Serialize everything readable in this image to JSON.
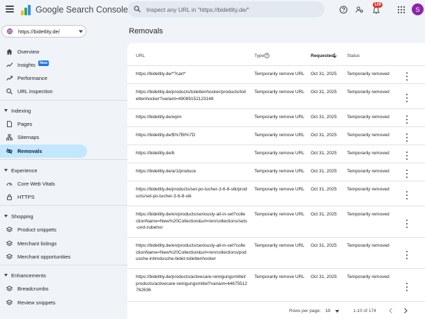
{
  "header": {
    "app_name": "Google Search Console",
    "search_placeholder": "Inspect any URL in \"https://bidetlity.de/\"",
    "notification_count": "129",
    "avatar_letter": "S"
  },
  "sidebar": {
    "property": "https://bidetlity.de/",
    "items_top": [
      {
        "label": "Overview",
        "icon": "home-icon"
      },
      {
        "label": "Insights",
        "icon": "insights-icon",
        "badge": "New"
      },
      {
        "label": "Performance",
        "icon": "trending-icon"
      },
      {
        "label": "URL inspection",
        "icon": "search-icon"
      }
    ],
    "sections": [
      {
        "label": "Indexing",
        "items": [
          "Pages",
          "Sitemaps",
          "Removals"
        ]
      },
      {
        "label": "Experience",
        "items": [
          "Core Web Vitals",
          "HTTPS"
        ]
      },
      {
        "label": "Shopping",
        "items": [
          "Product snippets",
          "Merchant listings",
          "Merchant opportunities"
        ]
      },
      {
        "label": "Enhancements",
        "items": [
          "Breadcrumbs",
          "Review snippets"
        ]
      }
    ],
    "active_item": "Removals"
  },
  "main": {
    "title": "Removals",
    "columns": {
      "url": "URL",
      "type": "Type",
      "requested": "Requested",
      "status": "Status"
    },
    "rows": [
      {
        "url": "https://bidetlity.de/*?cart*",
        "type": "Temporarily remove URL",
        "date": "Oct 31, 2025",
        "status": "Temporarily removed"
      },
      {
        "url": "https://bidetlity.de/products/toilettenhocker/products/toilettenhocker?variant=49089152123148",
        "type": "Temporarily remove URL",
        "date": "Oct 31, 2025",
        "status": "Temporarily removed"
      },
      {
        "url": "https://bidetlity.de/wpm",
        "type": "Temporarily remove URL",
        "date": "Oct 31, 2025",
        "status": "Temporarily removed"
      },
      {
        "url": "https://bidetlity.de/$%7Bt%7D",
        "type": "Temporarily remove URL",
        "date": "Oct 31, 2025",
        "status": "Temporarily removed"
      },
      {
        "url": "https://bidetlity.de/b",
        "type": "Temporarily remove URL",
        "date": "Oct 31, 2025",
        "status": "Temporarily removed"
      },
      {
        "url": "https://bidetlity.de/a/1/produce",
        "type": "Temporarily remove URL",
        "date": "Oct 31, 2025",
        "status": "Temporarily removed"
      },
      {
        "url": "https://bidetlity.de/products/set-po-tucher-3-6-8-stk/products/set-po-tucher-3-6-8-stk",
        "type": "Temporarily remove URL",
        "date": "Oct 31, 2025",
        "status": "Temporarily removed"
      },
      {
        "url": "https://bidetlity.de/en/products/seriously-all-in-set?collectionName=New%20Collection&url=/en/collections/sets-und-zubehor",
        "type": "Temporarily remove URL",
        "date": "Oct 31, 2025",
        "status": "Temporarily removed"
      },
      {
        "url": "https://bidetlity.de/en/products/seriously-all-in-set?collectionName=New%20Collection&url=/en/collections/podusche-intimdusche-bidet-toilettenhocker",
        "type": "Temporarily remove URL",
        "date": "Oct 31, 2025",
        "status": "Temporarily removed"
      },
      {
        "url": "https://bidetlity.de/products/activecare-reinigungsmittel/products/activecare-reinigungsmittel?variant=44675512762636",
        "type": "Temporarily remove URL",
        "date": "Oct 31, 2025",
        "status": "Temporarily removed"
      }
    ],
    "pagination": {
      "rows_label": "Rows per page:",
      "rows_value": "10",
      "range": "1-10 of 174"
    }
  },
  "colors": {
    "accent": "#1a73e8",
    "active_bg": "#c2e7ff",
    "avatar": "#8e24aa",
    "badge": "#d93025"
  }
}
